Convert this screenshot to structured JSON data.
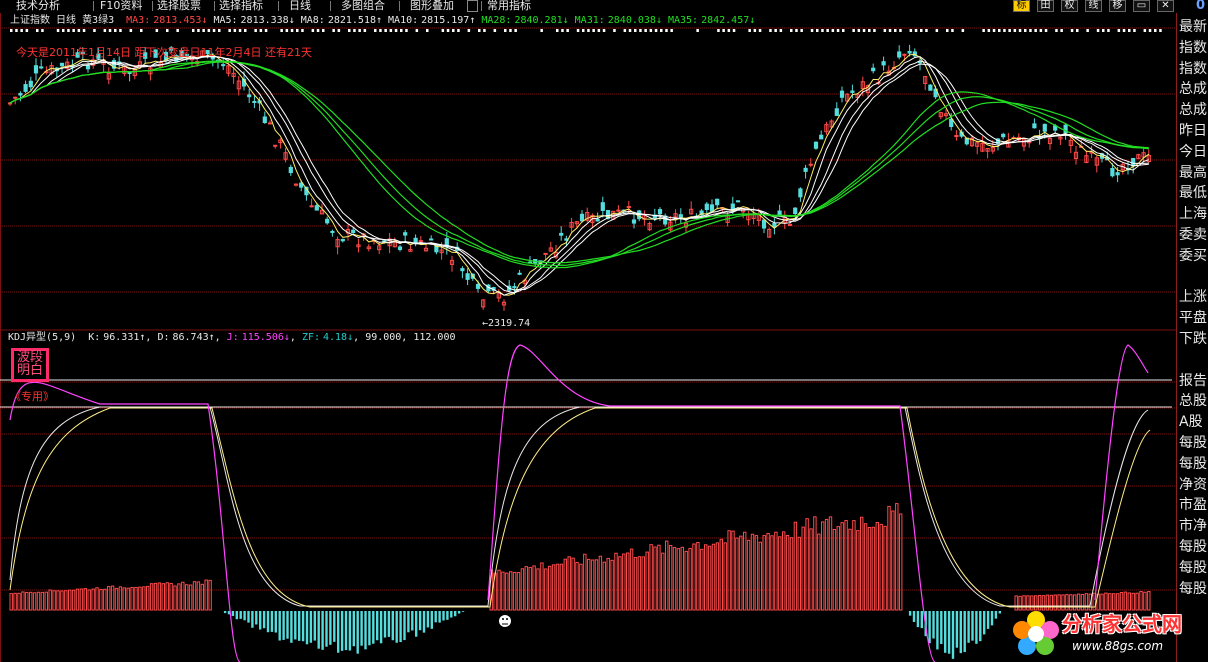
{
  "toolbar": {
    "items": [
      "技术分析",
      "F10资料",
      "选择股票",
      "选择指标",
      "日线",
      "多图组合",
      "图形叠加",
      "常用指标"
    ],
    "right_buttons": [
      "标",
      "田",
      "权",
      "线",
      "移"
    ],
    "active_right": "标",
    "zero_label": "0"
  },
  "header": {
    "title": "上证指数 日线",
    "mode": "黄3绿3",
    "ma_values": [
      {
        "label": "MA3:",
        "value": "2813.453",
        "arrow": "↓",
        "color": "#ff4444"
      },
      {
        "label": "MA5:",
        "value": "2813.338",
        "arrow": "↓",
        "color": "#e8e8e8"
      },
      {
        "label": "MA8:",
        "value": "2821.518",
        "arrow": "↑",
        "color": "#e8e8e8"
      },
      {
        "label": "MA10:",
        "value": "2815.197",
        "arrow": "↑",
        "color": "#e8e8e8"
      },
      {
        "label": "MA28:",
        "value": "2840.281",
        "arrow": "↓",
        "color": "#22dd22"
      },
      {
        "label": "MA31:",
        "value": "2840.038",
        "arrow": "↓",
        "color": "#22dd22"
      },
      {
        "label": "MA35:",
        "value": "2842.457",
        "arrow": "↓",
        "color": "#22dd22"
      }
    ],
    "note": "今天是2011年1月14日 距下次变盘日11年2月4日 还有21天"
  },
  "price_chart": {
    "low_label": "2319.74"
  },
  "kdj": {
    "title": "KDJ异型(5,9)",
    "k": {
      "label": "K:",
      "value": "96.331",
      "arrow": "↑",
      "color": "#e8e8e8"
    },
    "d": {
      "label": "D:",
      "value": "86.743",
      "arrow": "↑",
      "color": "#e8e8e8"
    },
    "j": {
      "label": "J:",
      "value": "115.506",
      "arrow": "↓",
      "color": "#ff44ff"
    },
    "zf": {
      "label": "ZF:",
      "value": "4.18",
      "arrow": "↓",
      "color": "#22cccc"
    },
    "levels": "99.000, 112.000",
    "badge_line1": "波段",
    "badge_line2": "明白",
    "badge_note": "《专用》"
  },
  "side_panel": {
    "rows": [
      "最新",
      "指数",
      "指数",
      "总成",
      "总成",
      "昨日",
      "今日",
      "最高",
      "最低",
      "上海",
      "委卖",
      "委买",
      "",
      "上涨",
      "平盘",
      "下跌",
      "",
      "报告",
      "总股",
      "A股",
      "每股",
      "每股",
      "净资",
      "市盈",
      "市净",
      "每股",
      "每股",
      "每股"
    ]
  },
  "logo": {
    "name": "分析家公式网",
    "url": "www.88gs.com"
  },
  "colors": {
    "up": "#ff4a4a",
    "down": "#55dddd",
    "ma_short": "#ffffff",
    "ma_yellow": "#ffee66",
    "ma_long": "#22dd22",
    "j_line": "#ff44ff",
    "grid": "#7a1010"
  }
}
